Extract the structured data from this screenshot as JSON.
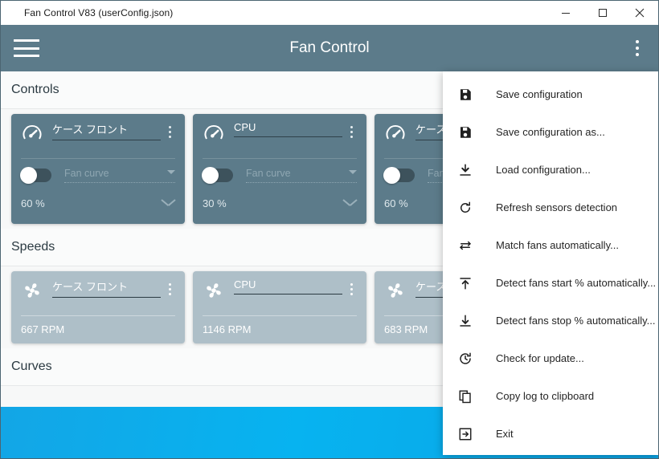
{
  "window": {
    "title": "Fan Control V83 (userConfig.json)",
    "minimize_label": "Minimize",
    "maximize_label": "Maximize",
    "close_label": "Close"
  },
  "appbar": {
    "menu_icon": "hamburger-icon",
    "title": "Fan Control",
    "overflow_icon": "kebab-menu-icon"
  },
  "sections": [
    {
      "id": "controls",
      "title": "Controls"
    },
    {
      "id": "speeds",
      "title": "Speeds"
    },
    {
      "id": "curves",
      "title": "Curves"
    }
  ],
  "controls": [
    {
      "icon": "gauge-icon",
      "name": "ケース フロント",
      "toggle_on": false,
      "curve_placeholder": "Fan curve",
      "percent": "60 %"
    },
    {
      "icon": "gauge-icon",
      "name": "CPU",
      "toggle_on": false,
      "curve_placeholder": "Fan curve",
      "percent": "30 %"
    },
    {
      "icon": "gauge-icon",
      "name": "ケース リア",
      "toggle_on": false,
      "curve_placeholder": "Fan curve",
      "percent": "60 %"
    }
  ],
  "speeds": [
    {
      "icon": "fan-icon",
      "name": "ケース フロント",
      "rpm": "667 RPM"
    },
    {
      "icon": "fan-icon",
      "name": "CPU",
      "rpm": "1146 RPM"
    },
    {
      "icon": "fan-icon",
      "name": "ケース リア",
      "rpm": "683 RPM"
    }
  ],
  "menu": {
    "items": [
      {
        "icon": "save-icon",
        "label": "Save configuration"
      },
      {
        "icon": "save-as-icon",
        "label": "Save configuration as..."
      },
      {
        "icon": "download-icon",
        "label": "Load configuration..."
      },
      {
        "icon": "refresh-icon",
        "label": "Refresh sensors detection"
      },
      {
        "icon": "swap-arrows-icon",
        "label": "Match fans automatically..."
      },
      {
        "icon": "arrow-up-bar-icon",
        "label": "Detect fans start % automatically..."
      },
      {
        "icon": "arrow-down-bar-icon",
        "label": "Detect fans stop % automatically..."
      },
      {
        "icon": "clock-refresh-icon",
        "label": "Check for update..."
      },
      {
        "icon": "copy-icon",
        "label": "Copy log to clipboard"
      },
      {
        "icon": "exit-icon",
        "label": "Exit"
      }
    ]
  },
  "colors": {
    "header": "#5c7b8a",
    "control_card": "#5c7b8a",
    "speed_card": "#aebfc8",
    "accent_blue": "#0aa8e8",
    "content_bg": "#f7f8f8"
  }
}
